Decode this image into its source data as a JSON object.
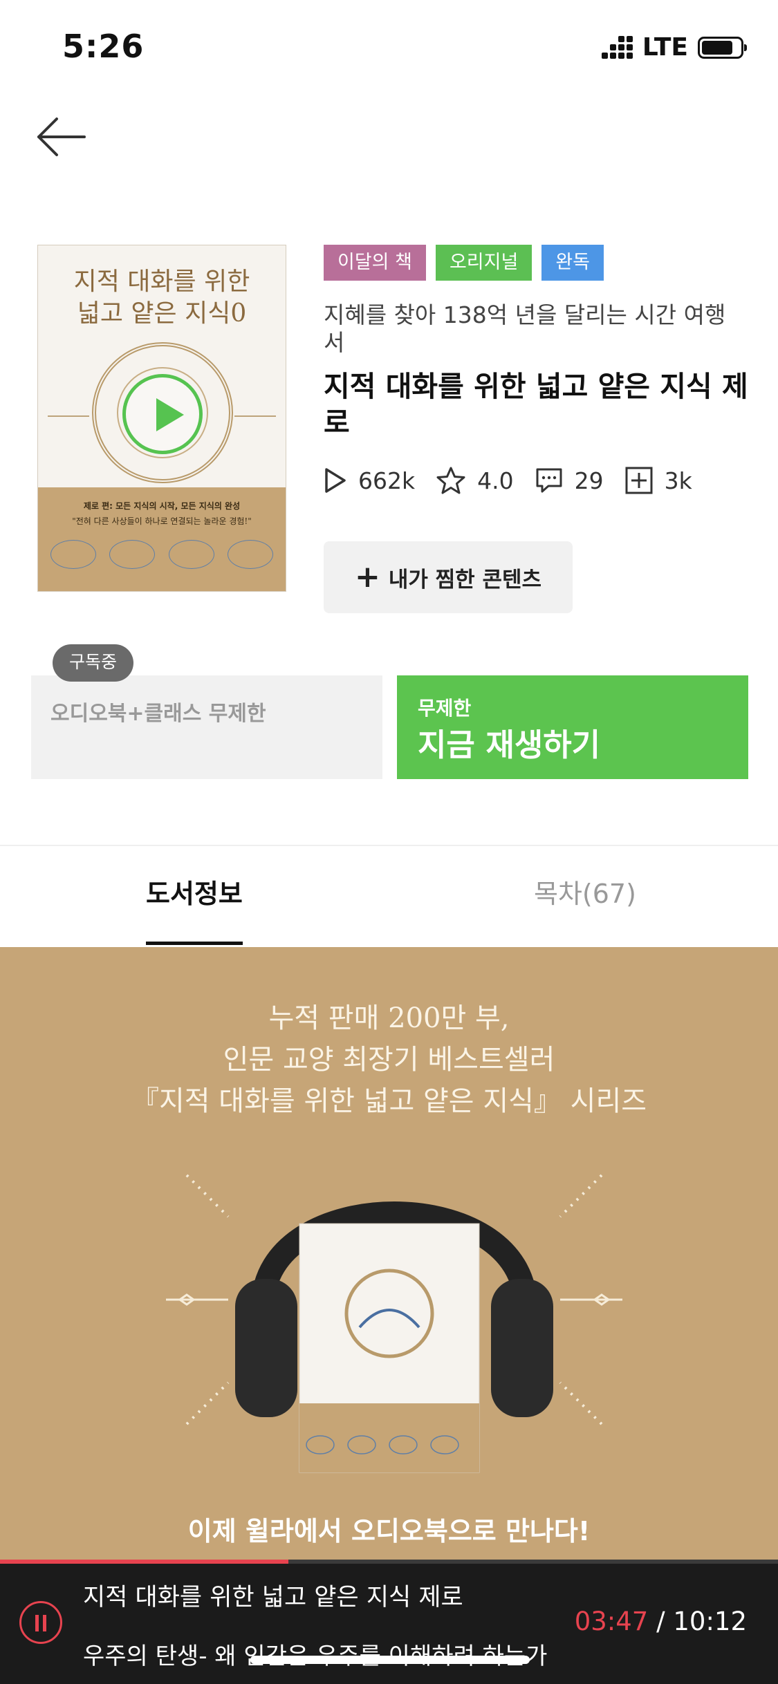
{
  "status_bar": {
    "time": "5:26",
    "network": "LTE"
  },
  "book": {
    "cover": {
      "title_line1": "지적 대화를 위한",
      "title_line2": "넓고 얕은 지식0",
      "subtitle": "제로 편: 모든 지식의 시작, 모든 지식의 완성",
      "quote": "\"전혀 다른 사상들이 하나로 연결되는 놀라운 경험!\""
    },
    "badges": [
      "이달의 책",
      "오리지널",
      "완독"
    ],
    "badge_colors": [
      "#b86f99",
      "#5cbf53",
      "#4d96e6"
    ],
    "subtitle": "지혜를 찾아 138억 년을 달리는 시간 여행서",
    "title": "지적 대화를 위한 넓고 얕은 지식 제로",
    "stats": {
      "plays": "662k",
      "rating": "4.0",
      "comments": "29",
      "adds": "3k"
    },
    "wishlist_label": "내가 찜한 콘텐츠"
  },
  "subscription": {
    "tag": "구독중",
    "plan": "오디오북+클래스 무제한",
    "play_small": "무제한",
    "play_big": "지금 재생하기",
    "accent": "#5cc44f"
  },
  "tabs": {
    "info": "도서정보",
    "toc": "목차(67)"
  },
  "promo": {
    "line1": "누적 판매 200만 부,",
    "line2": "인문 교양 최장기 베스트셀러",
    "line3": "『지적 대화를 위한 넓고 얕은 지식』 시리즈",
    "cta": "이제 윌라에서 오디오북으로 만나다!",
    "background": "#c6a577"
  },
  "player": {
    "title": "지적 대화를 위한 넓고 얕은 지식 제로",
    "chapter": "우주의 탄생- 왜 인간은 우주를 이해하려 하는가",
    "current": "03:47",
    "separator": " / ",
    "total": "10:12",
    "progress": 0.371,
    "accent": "#e7434f"
  }
}
